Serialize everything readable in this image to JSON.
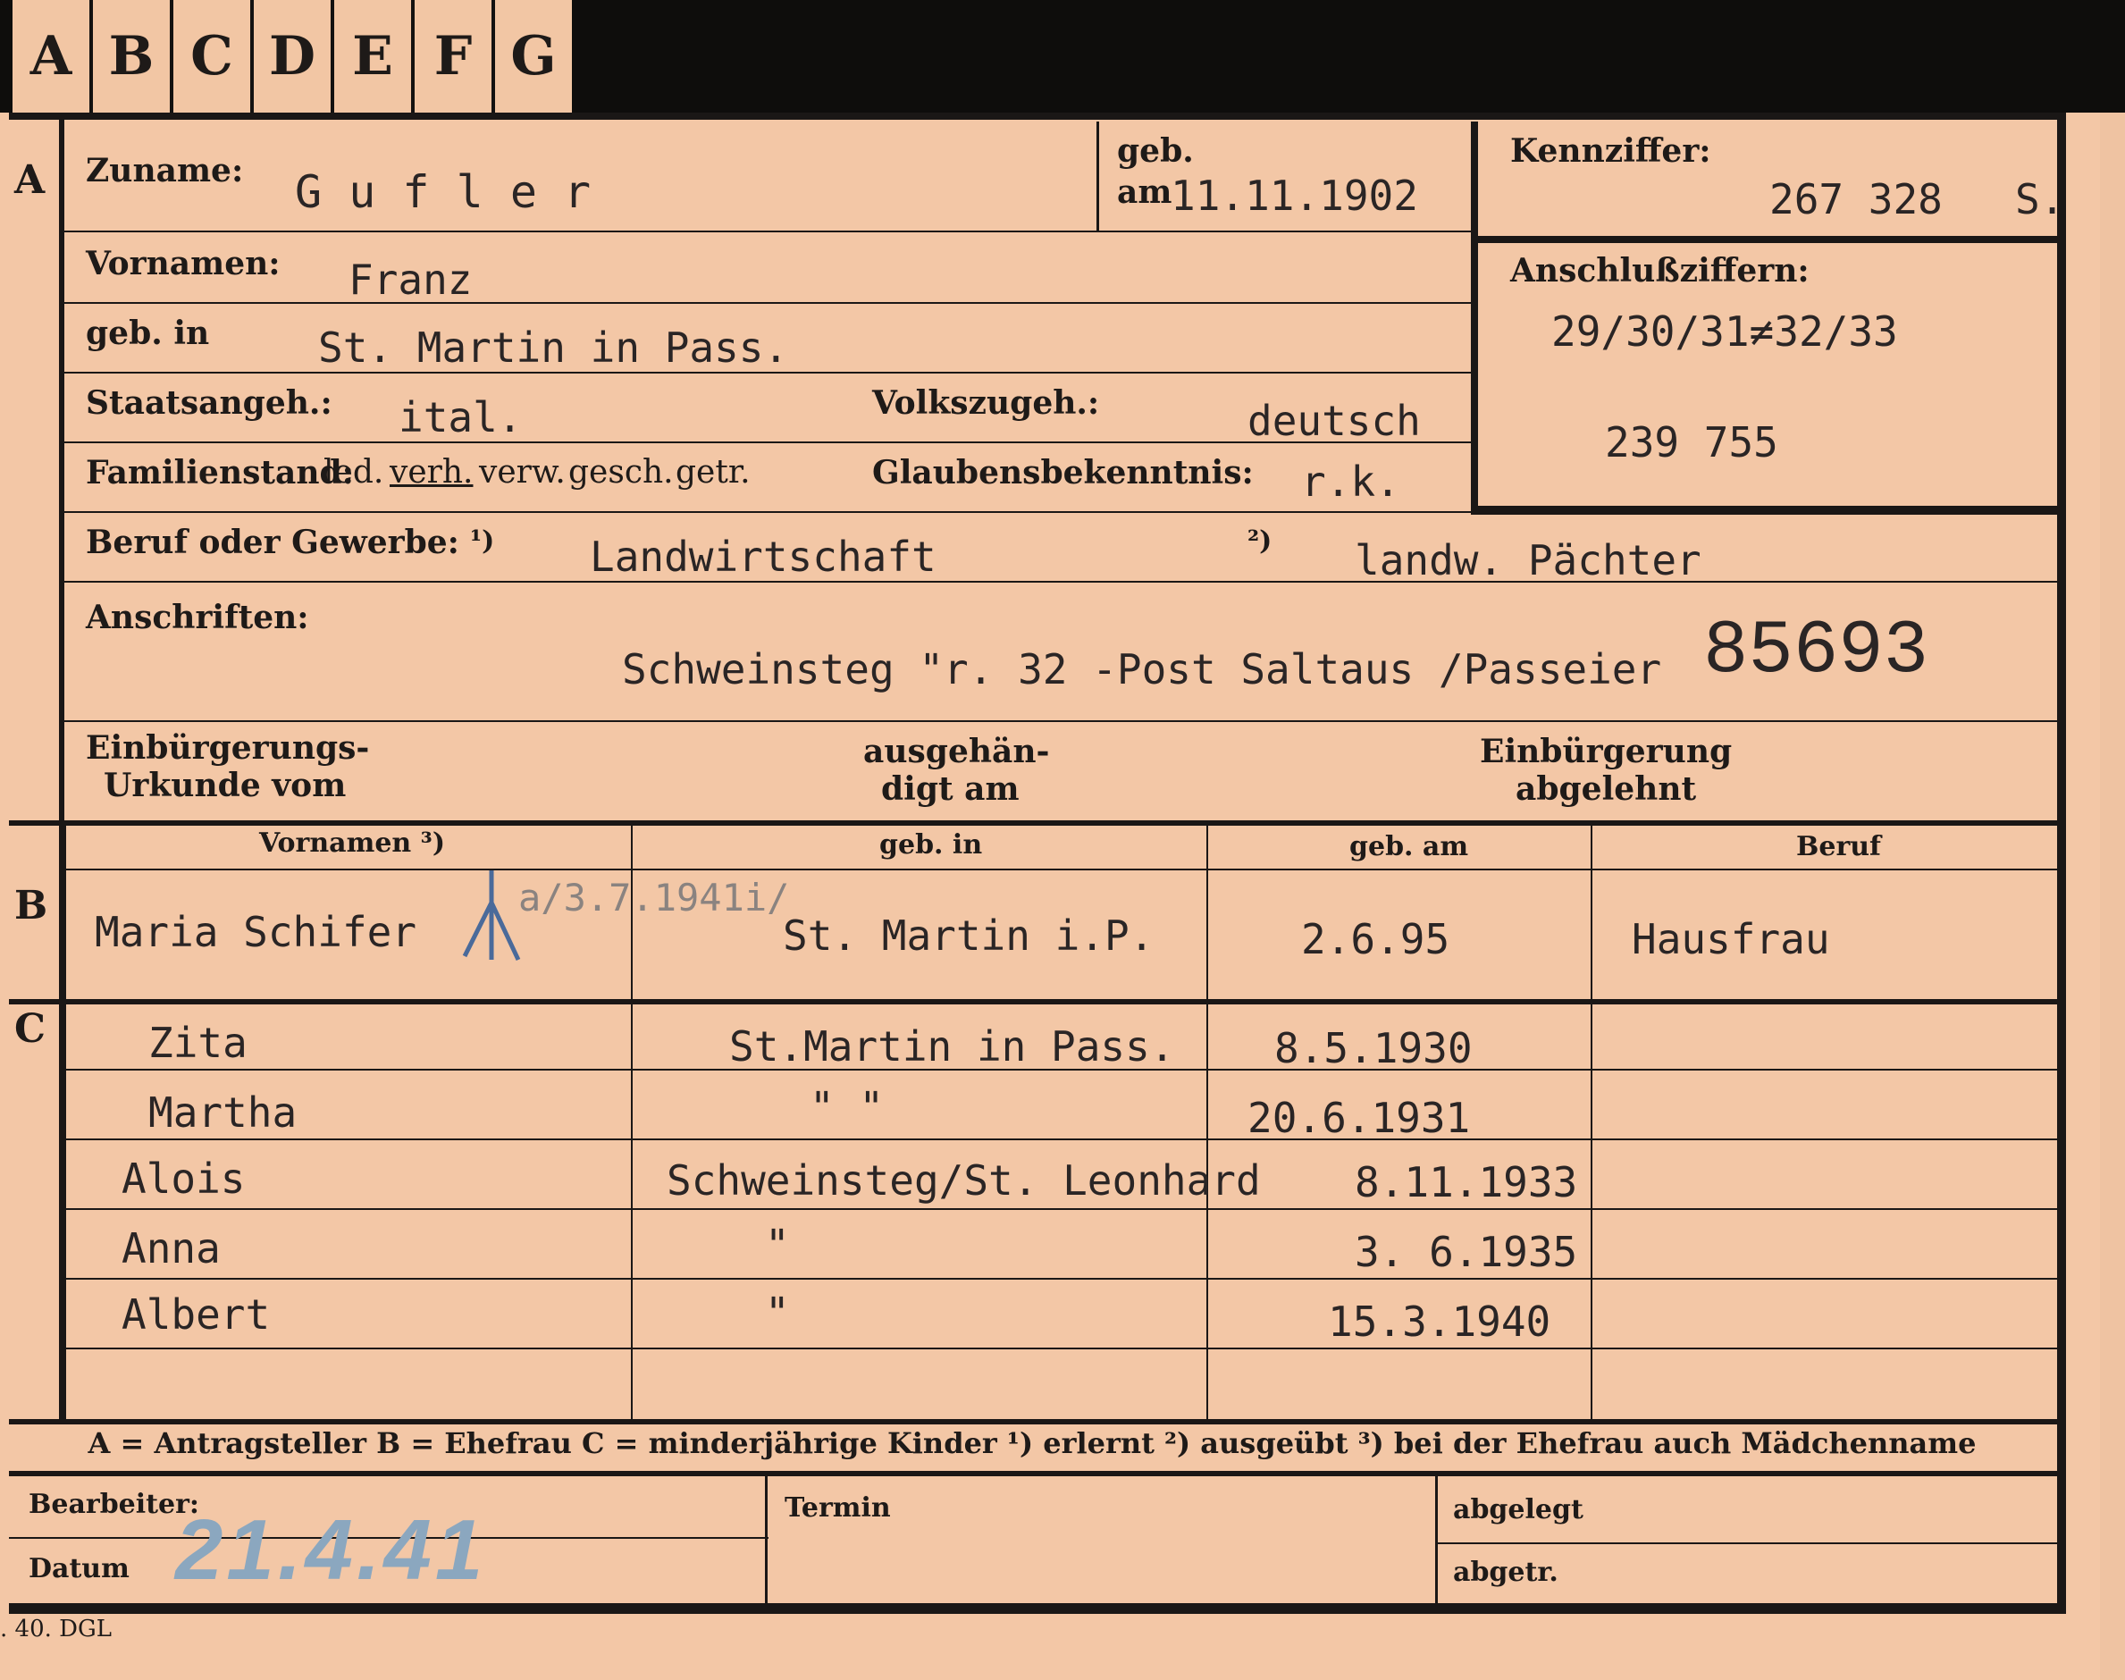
{
  "tabs": [
    "A",
    "B",
    "C",
    "D",
    "E",
    "F",
    "G"
  ],
  "sections": {
    "a": "A",
    "b": "B",
    "c": "C"
  },
  "applicant": {
    "surname_label": "Zuname:",
    "surname": "G u f l e r",
    "born_label": "geb.",
    "born_am": "am",
    "born_date": "11.11.1902",
    "kennziffer_label": "Kennziffer:",
    "kennziffer": "267 328",
    "kennziffer_suffix": "S.",
    "vornamen_label": "Vornamen:",
    "vornamen": "Franz",
    "anschluss_label": "Anschlußziffern:",
    "anschluss_1": "29/30/31≠32/33",
    "anschluss_2": "239 755",
    "geb_in_label": "geb. in",
    "geb_in": "St. Martin in Pass.",
    "staat_label": "Staatsangeh.:",
    "staat": "ital.",
    "volk_label": "Volkszugeh.:",
    "volk": "deutsch",
    "familienstand_label": "Familienstand:",
    "familienstand_options": [
      "led.",
      "verh.",
      "verw.",
      "gesch.",
      "getr."
    ],
    "glaube_label": "Glaubensbekenntnis:",
    "glaube": "r.k.",
    "beruf_label": "Beruf oder Gewerbe:",
    "note1": "¹)",
    "beruf1": "Landwirtschaft",
    "note2": "²)",
    "beruf2": "landw. Pächter",
    "anschrift_label": "Anschriften:",
    "anschrift": "Schweinsteg \"r. 32 -Post Saltaus /Passeier",
    "big_number": "85693",
    "einb_urkunde_1": "Einbürgerungs-",
    "einb_urkunde_2": "Urkunde vom",
    "ausgehaend_1": "ausgehän-",
    "ausgehaend_2": "digt am",
    "einb_abgelehnt_1": "Einbürgerung",
    "einb_abgelehnt_2": "abgelehnt"
  },
  "table": {
    "headers": [
      "Vornamen ³)",
      "geb. in",
      "geb. am",
      "Beruf"
    ],
    "wife": {
      "name": "Maria Schifer",
      "annot": "a/3.7.1941i/",
      "place": "St. Martin i.P.",
      "date": "2.6.95",
      "beruf": "Hausfrau"
    },
    "children": [
      {
        "name": "Zita",
        "place": "St.Martin in Pass.",
        "date": "8.5.1930"
      },
      {
        "name": "Martha",
        "place": "\"          \"",
        "date": "20.6.1931"
      },
      {
        "name": "Alois",
        "place": "Schweinsteg/St. Leonhard",
        "date": "8.11.1933"
      },
      {
        "name": "Anna",
        "place": "\"",
        "date": "3. 6.1935"
      },
      {
        "name": "Albert",
        "place": "\"",
        "date": "15.3.1940"
      }
    ]
  },
  "legend": "A = Antragsteller   B = Ehefrau   C = minderjährige Kinder   ¹) erlernt   ²) ausgeübt   ³) bei der Ehefrau auch Mädchenname",
  "footer": {
    "bearbeiter_label": "Bearbeiter:",
    "datum_label": "Datum",
    "datum_stamp": "21.4.41",
    "termin_label": "Termin",
    "abgelegt_label": "abgelegt",
    "abgetr_label": "abgetr.",
    "form_code": ". 40. DGL"
  }
}
